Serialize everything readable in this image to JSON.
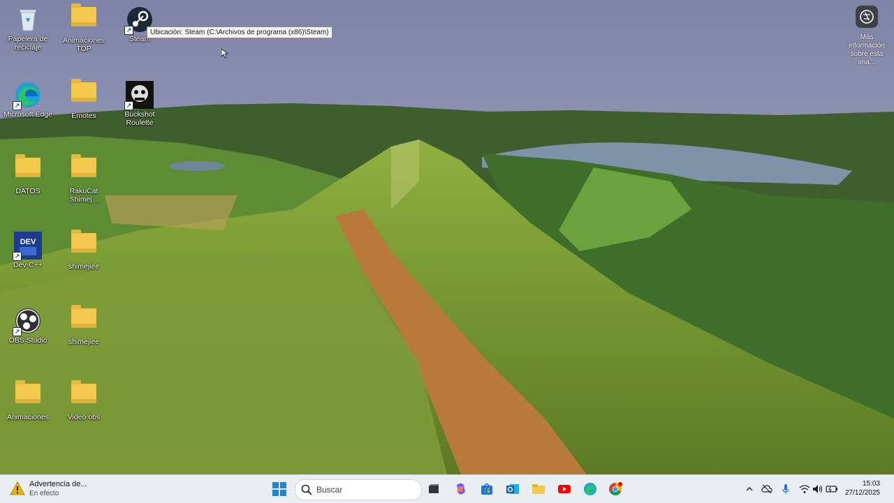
{
  "desktop": {
    "icons": [
      {
        "label": "Papelera de reciclaje",
        "icon": "recycle-bin-icon"
      },
      {
        "label": "Animaciones TOP",
        "icon": "folder-icon"
      },
      {
        "label": "Steam",
        "icon": "steam-icon"
      },
      {
        "label": "Microsoft Edge",
        "icon": "edge-icon"
      },
      {
        "label": "Emotes",
        "icon": "folder-icon"
      },
      {
        "label": "Buckshot Roulette",
        "icon": "buckshot-roulette-icon"
      },
      {
        "label": "DATOS",
        "icon": "folder-icon"
      },
      {
        "label": "RakuCat Shimej...",
        "icon": "folder-icon"
      },
      {
        "label": "Dev-C++",
        "icon": "devcpp-icon"
      },
      {
        "label": "shimejiee",
        "icon": "folder-icon"
      },
      {
        "label": "OBS Studio",
        "icon": "obs-icon"
      },
      {
        "label": "shimejiee",
        "icon": "folder-icon"
      },
      {
        "label": "Animaciones",
        "icon": "folder-icon"
      },
      {
        "label": "Video obs",
        "icon": "folder-icon"
      }
    ],
    "tooltip": "Ubicación: Steam (C:\\Archivos de programa (x86)\\Steam)",
    "spotlight_label": "Más información sobre esta ima..."
  },
  "taskbar": {
    "weather_title": "Advertencia de...",
    "weather_subtitle": "En efecto",
    "search_placeholder": "Buscar",
    "pinned": [
      "start-icon",
      "task-view-icon",
      "copilot-icon",
      "store-icon",
      "outlook-icon",
      "file-explorer-icon",
      "youtube-icon",
      "edge-icon",
      "chrome-icon"
    ],
    "time": "15:03",
    "date": "27/12/2025"
  },
  "colors": {
    "folder": "#f2c94c",
    "taskbar": "#e9eef3",
    "sky": "#8f93b0"
  }
}
